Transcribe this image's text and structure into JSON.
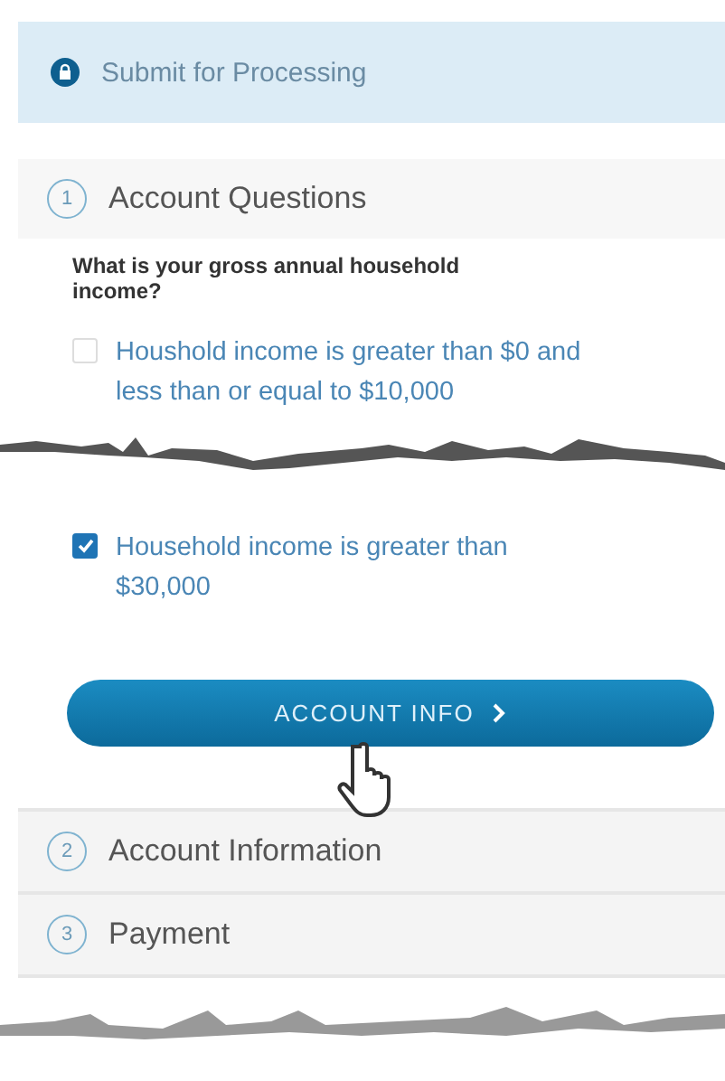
{
  "banner": {
    "title": "Submit for Processing"
  },
  "sections": [
    {
      "number": "1",
      "title": "Account Questions",
      "expanded": true
    },
    {
      "number": "2",
      "title": "Account Information",
      "expanded": false
    },
    {
      "number": "3",
      "title": "Payment",
      "expanded": false
    }
  ],
  "question": "What is your gross annual household income?",
  "options": [
    {
      "label": "Houshold income is greater than $0 and less than or equal to $10,000",
      "checked": false
    },
    {
      "label": "Household income is greater than $30,000",
      "checked": true
    }
  ],
  "button": {
    "label": "ACCOUNT INFO"
  }
}
